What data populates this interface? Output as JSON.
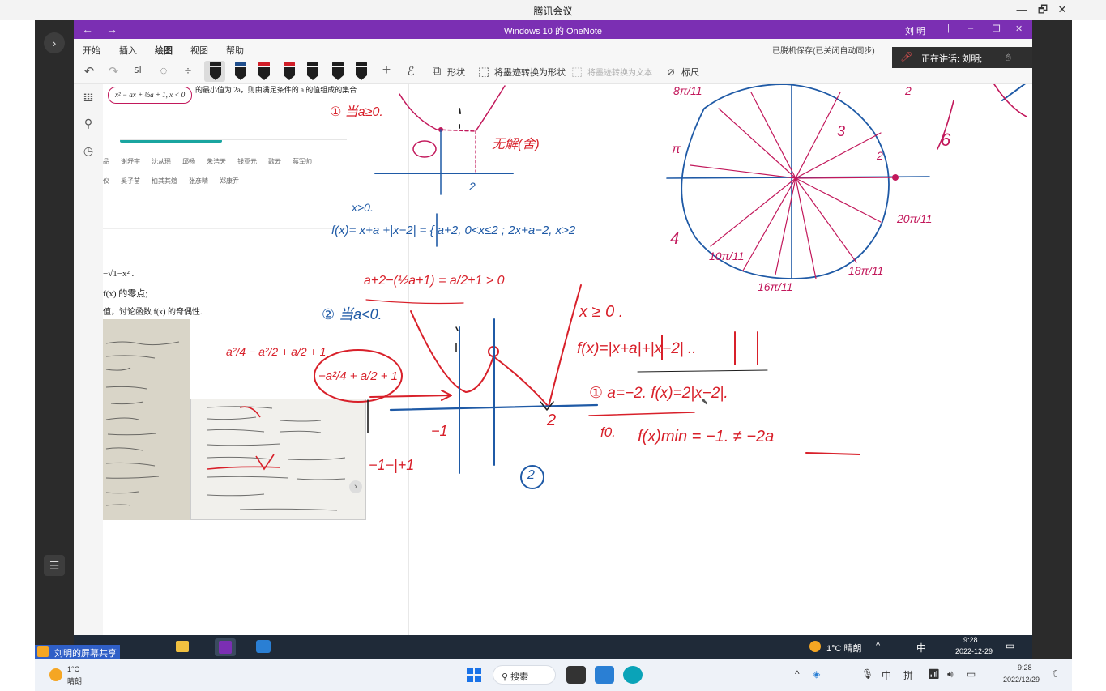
{
  "meeting": {
    "title": "腾讯会议",
    "win_min": "—",
    "win_restore": "🗗",
    "win_close": "✕"
  },
  "onenote": {
    "title": "Windows 10 的 OneNote",
    "back": "←",
    "forward": "→",
    "user": "刘 明",
    "menu": [
      "开始",
      "插入",
      "绘图",
      "视图",
      "帮助"
    ],
    "sync_status": "已脱机保存(已关闭自动同步)",
    "toolbar": {
      "shapes_label": "形状",
      "ink_to_shape_label": "将墨迹转换为形状",
      "ink_to_text_label": "将墨迹转换为文本",
      "ruler_label": "标尺"
    },
    "pen_colors": [
      "#1e1e1e",
      "#1f4e8c",
      "#d01e28",
      "#d01e28",
      "#1e1e1e",
      "#1e1e1e",
      "#1e1e1e"
    ]
  },
  "speaker": {
    "text": "正在讲话: 刘明;"
  },
  "page": {
    "problem_tail": "的最小值为 2a，则由满足条件的 a 的值组成的集合",
    "piecewise": "x² − ax + ½a + 1,  x < 0",
    "names_row1": [
      "品",
      "谢舒宇",
      "沈从瑶",
      "邱畅",
      "朱浩天",
      "钱亚元",
      "歌云",
      "蒋军帅"
    ],
    "names_row2": [
      "仪",
      "奚子苗",
      "柏其其煊",
      "张彦晴",
      "郑康乔"
    ],
    "snippet_lines": [
      "−√1−x² .",
      "f(x) 的零点;",
      "值，讨论函数 f(x) 的奇偶性."
    ]
  },
  "ink": {
    "case1": "① 当a≥0.",
    "no_solution": "无解(舍)",
    "two_top": "2",
    "x_pos": "x>0.",
    "f_def": "f(x)= x+a +|x−2| = { a+2,  0<x≤2 ;  2x+a−2,  x>2",
    "ineq": "a+2−(½a+1) = a/2+1 > 0",
    "case2": "② 当a<0.",
    "xge0": "x ≥ 0 .",
    "fx_abs": "f(x)=|x+a|+|x−2| ..",
    "circled_one": "① a=−2. f(x)=2|x−2|.",
    "f0": "f0.",
    "fmin": "f(x)min = −1. ≠ −2a",
    "a2_expr": "a²/4 − a²/2 + a/2 + 1",
    "circled_expr": "−a²/4 + a/2 + 1",
    "neg_one": "−1",
    "two_b": "2",
    "small": "−1−|+1",
    "circled_two": "2",
    "circle_labels": [
      "8π/11",
      "π",
      "6",
      "20π/11",
      "4",
      "10π/11",
      "16π/11",
      "18π/11",
      "2",
      "3"
    ],
    "arrow_label": "2"
  },
  "taskbar": {
    "share_label": "刘明的屏幕共享",
    "weather_temp": "1°C",
    "weather_desc": "晴朗",
    "inner_weather": "1°C 晴朗",
    "inner_time": "9:28",
    "inner_date": "2022-12-29",
    "search_label": "搜索",
    "ime_zh": "中",
    "ime_pin": "拼",
    "time": "9:28",
    "date": "2022/12/29"
  },
  "colors": {
    "onenote_purple": "#7b2fb3",
    "ink_red": "#d8202a",
    "ink_blue": "#1f5aa6",
    "ink_pink": "#c2185b",
    "axis_blue": "#1f66a8"
  }
}
